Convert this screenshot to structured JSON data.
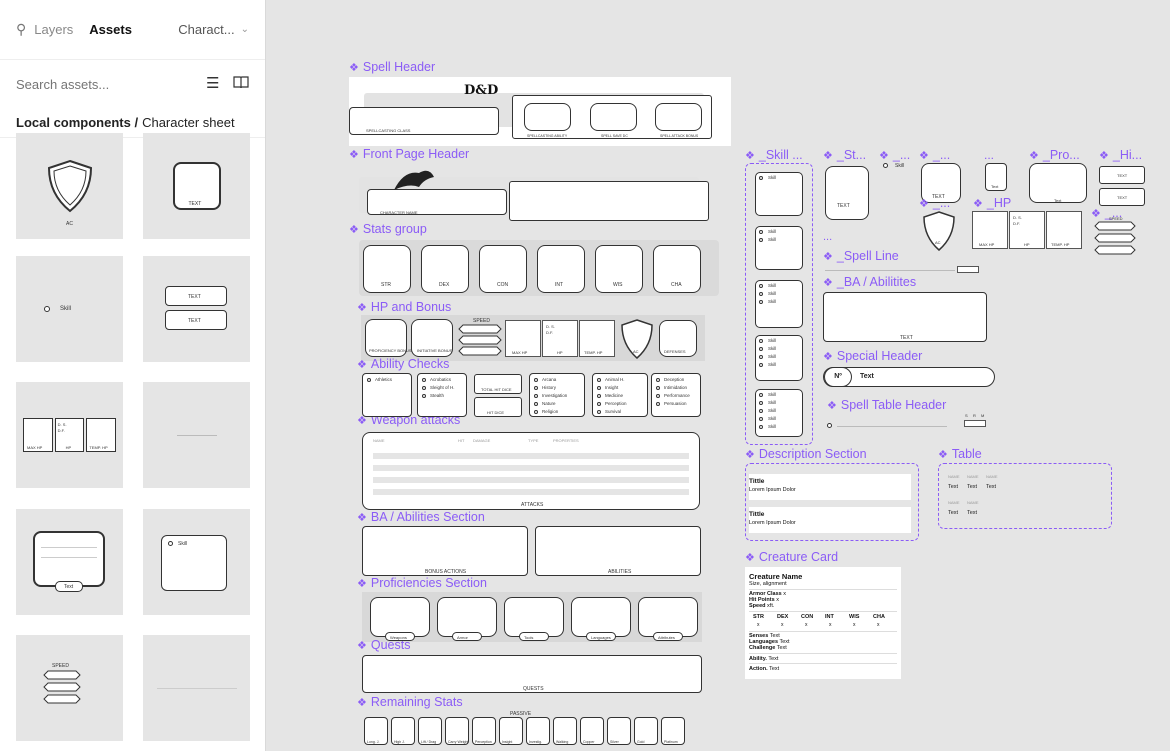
{
  "sidebar": {
    "tabs": [
      {
        "label": "Layers"
      },
      {
        "label": "Assets"
      }
    ],
    "library_label": "Charact...",
    "search_placeholder": "Search assets...",
    "breadcrumb_root": "Local components /",
    "breadcrumb_page": "Character sheet",
    "tile_labels": {
      "ac": "AC",
      "text": "TEXT",
      "skill": "Skill",
      "text_a": "TEXT",
      "text_b": "TEXT",
      "max_hp": "MAX HP",
      "hp": "HP",
      "temp_hp": "TEMP. HP",
      "ds": "D. S.",
      "df": "D.F.",
      "text_tag": "Text",
      "skill2": "Skill",
      "speed": "SPEED"
    }
  },
  "canvas": {
    "frames": {
      "spell_header": "Spell Header",
      "front_page_header": "Front Page Header",
      "stats_group": "Stats group",
      "hp_and_bonus": "HP and Bonus",
      "ability_checks": "Ability Checks",
      "weapon_attacks": "Weapon attacks",
      "ba_abilities_section": "BA / Abilities Section",
      "proficiencies_section": "Proficiencies Section",
      "quests": "Quests",
      "remaining_stats": "Remaining Stats",
      "skill": "_Skill ...",
      "st": "_St...",
      "u1": "_...",
      "u2": "_...",
      "pro": "_Pro...",
      "hi": "_Hi...",
      "hp": "_HP",
      "u3": "_...",
      "u4": "_...",
      "spell_line": "_Spell Line",
      "ba_abilitites": "_BA / Abilitites",
      "special_header": "Special Header",
      "spell_table_header": "Spell Table Header",
      "description_section": "Description Section",
      "table": "Table",
      "creature_card": "Creature Card"
    },
    "spell_header_boxes": [
      "SPELLCASTING ABILITY",
      "SPELL SAVE DC",
      "SPELL ATTACK BONUS"
    ],
    "spell_header_ribbon": "SPELLCASTING CLASS",
    "dnd_logo": "D&D",
    "front_header_ribbon": "CHARACTER NAME",
    "stats": [
      "STR",
      "DEX",
      "CON",
      "INT",
      "WIS",
      "CHA"
    ],
    "hp_bonus": {
      "boxes": [
        "PROFICIENCY BONUS",
        "INITIATIVE BONUS",
        "MAX HP",
        "HP",
        "TEMP. HP",
        "AC",
        "DEFENSES"
      ],
      "speed": "SPEED",
      "ds": "D. S.",
      "df": "D.F."
    },
    "ability_checks": {
      "col1": [
        "Athletics"
      ],
      "col2": [
        "Acrobatics",
        "Sleight of H.",
        "Stealth"
      ],
      "hit_dice": [
        "TOTAL HIT DICE",
        "HIT DICE"
      ],
      "col3": [
        "Arcana",
        "History",
        "Investigation",
        "Nature",
        "Religion"
      ],
      "col4": [
        "Animal H.",
        "Insight",
        "Medicine",
        "Perception",
        "Survival"
      ],
      "col5": [
        "Deception",
        "Intimidation",
        "Performance",
        "Persuasion"
      ]
    },
    "attacks": {
      "headers": [
        "NAME",
        "HIT",
        "DAMAGE",
        "TYPE",
        "PROPERTIES"
      ],
      "footer": "ATTACKS"
    },
    "ba_section": [
      "BONUS ACTIONS",
      "ABILITIES"
    ],
    "proficiencies": [
      "Weapons",
      "Armor",
      "Tools",
      "Languages",
      "Attributes"
    ],
    "quests_label": "QUESTS",
    "remaining_stats": {
      "header": "PASSIVE",
      "labels": [
        "Long. J.",
        "High J.",
        "Lift / Drag",
        "Carry Weight",
        "Perception",
        "Insight",
        "Investig.",
        "Walking",
        "Copper",
        "Silver",
        "Gold",
        "Platinum"
      ]
    },
    "skill_item": "Skill",
    "special_header": {
      "num": "Nº",
      "text": "Text"
    },
    "description": {
      "title1": "Tittle",
      "body1": "Lorem Ipsum Dolor",
      "title2": "Tittle",
      "body2": "Lorem Ipsum Dolor"
    },
    "table": {
      "head1": [
        "NAME",
        "NAME",
        "NAME"
      ],
      "row1": [
        "Text",
        "Text",
        "Text"
      ],
      "head2": [
        "NAME",
        "NAME"
      ],
      "row2": [
        "Text",
        "Text"
      ]
    },
    "creature_card": {
      "name": "Creature Name",
      "size": "Size, alignment",
      "armor_label": "Armor Class",
      "armor_val": "x",
      "hp_label": "Hit Points",
      "hp_val": "x",
      "speed_label": "Speed",
      "speed_val": "xft.",
      "stats": [
        "STR",
        "DEX",
        "CON",
        "INT",
        "WIS",
        "CHA"
      ],
      "stat_val": "x",
      "senses_label": "Senses",
      "senses_val": "Text",
      "languages_label": "Languages",
      "languages_val": "Text",
      "challenge_label": "Challenge",
      "challenge_val": "Text",
      "ability_label": "Ability.",
      "ability_val": "Text",
      "action_label": "Action.",
      "action_val": "Text"
    },
    "misc_labels": {
      "text": "TEXT",
      "text_small": "Text",
      "ac": "AC",
      "skill": "Skill",
      "max_hp": "MAX HP",
      "hp": "HP",
      "temp_hp": "TEMP. HP",
      "speed": "SPEED",
      "ds": "D. S.",
      "df": "D.F.",
      "dots": "...",
      "spell_table_cols": [
        "S",
        "R",
        "M"
      ]
    }
  }
}
